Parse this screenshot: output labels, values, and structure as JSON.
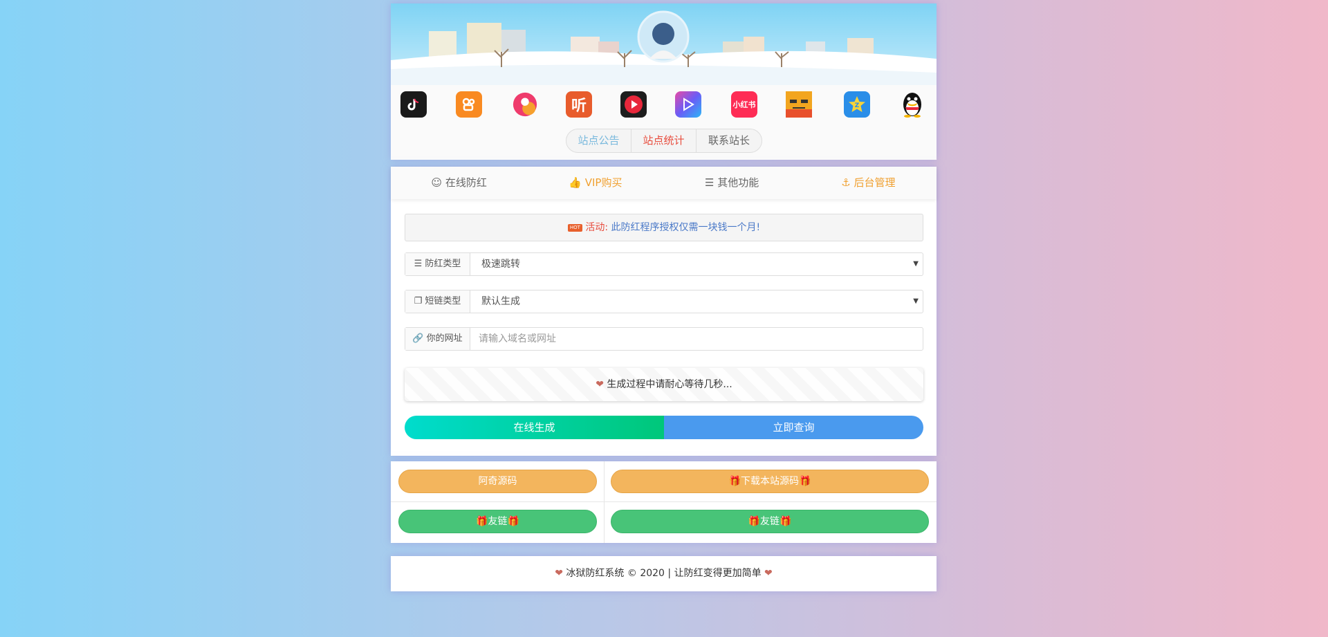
{
  "header": {
    "tabs": [
      {
        "label": "站点公告"
      },
      {
        "label": "站点统计"
      },
      {
        "label": "联系站长"
      }
    ],
    "app_icons": [
      {
        "name": "tiktok-icon",
        "color": "#1a1a1a"
      },
      {
        "name": "kuaishou-icon",
        "color": "#f98a21"
      },
      {
        "name": "weishi-icon",
        "color": "#ef3b6c"
      },
      {
        "name": "ting-icon",
        "color": "#e85c2c"
      },
      {
        "name": "video-play-icon",
        "color": "#1d1d1d"
      },
      {
        "name": "bilibili-play-icon",
        "color": "#6b5cf6"
      },
      {
        "name": "xiaohongshu-icon",
        "color": "#fe2c55"
      },
      {
        "name": "meme-face-icon",
        "color": "#f2a51f"
      },
      {
        "name": "qzone-icon",
        "color": "#2a8ee8"
      },
      {
        "name": "qq-penguin-icon",
        "color": "#111111"
      }
    ],
    "xiaohongshu_text": "小红书",
    "ting_text": "听"
  },
  "nav": {
    "items": [
      {
        "label": "在线防红"
      },
      {
        "label": "VIP购买"
      },
      {
        "label": "其他功能"
      },
      {
        "label": "后台管理"
      }
    ]
  },
  "notice": {
    "hot": "HOT",
    "label": "活动:",
    "text": "此防红程序授权仅需一块钱一个月!"
  },
  "form": {
    "type_label": "防红类型",
    "type_value": "极速跳转",
    "shortlink_label": "短链类型",
    "shortlink_value": "默认生成",
    "url_label": "你的网址",
    "url_placeholder": "请输入域名或网址",
    "progress_text": "生成过程中请耐心等待几秒..."
  },
  "buttons": {
    "generate": "在线生成",
    "query": "立即查询"
  },
  "links": {
    "aqi_source": "阿奇源码",
    "download_source": "下载本站源码",
    "friend_link_1": "友链",
    "friend_link_2": "友链"
  },
  "footer": {
    "text": "冰狱防红系统 © 2020 | 让防红变得更加简单"
  },
  "colors": {
    "accent_orange": "#f0a030",
    "accent_red": "#e84c3d",
    "generate_start": "#00dccd",
    "generate_end": "#00c77a",
    "query_blue": "#4a9aee",
    "pill_orange": "#f3b55d",
    "pill_green": "#48c478"
  }
}
